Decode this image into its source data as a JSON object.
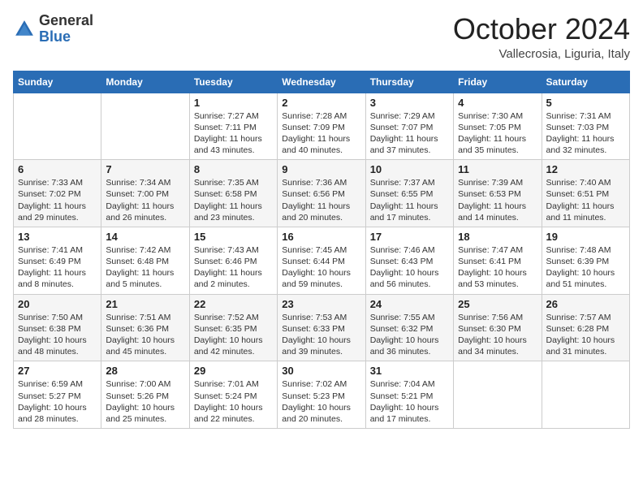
{
  "header": {
    "logo_general": "General",
    "logo_blue": "Blue",
    "month_title": "October 2024",
    "subtitle": "Vallecrosia, Liguria, Italy"
  },
  "days_of_week": [
    "Sunday",
    "Monday",
    "Tuesday",
    "Wednesday",
    "Thursday",
    "Friday",
    "Saturday"
  ],
  "weeks": [
    [
      {
        "day": "",
        "sunrise": "",
        "sunset": "",
        "daylight": ""
      },
      {
        "day": "",
        "sunrise": "",
        "sunset": "",
        "daylight": ""
      },
      {
        "day": "1",
        "sunrise": "Sunrise: 7:27 AM",
        "sunset": "Sunset: 7:11 PM",
        "daylight": "Daylight: 11 hours and 43 minutes."
      },
      {
        "day": "2",
        "sunrise": "Sunrise: 7:28 AM",
        "sunset": "Sunset: 7:09 PM",
        "daylight": "Daylight: 11 hours and 40 minutes."
      },
      {
        "day": "3",
        "sunrise": "Sunrise: 7:29 AM",
        "sunset": "Sunset: 7:07 PM",
        "daylight": "Daylight: 11 hours and 37 minutes."
      },
      {
        "day": "4",
        "sunrise": "Sunrise: 7:30 AM",
        "sunset": "Sunset: 7:05 PM",
        "daylight": "Daylight: 11 hours and 35 minutes."
      },
      {
        "day": "5",
        "sunrise": "Sunrise: 7:31 AM",
        "sunset": "Sunset: 7:03 PM",
        "daylight": "Daylight: 11 hours and 32 minutes."
      }
    ],
    [
      {
        "day": "6",
        "sunrise": "Sunrise: 7:33 AM",
        "sunset": "Sunset: 7:02 PM",
        "daylight": "Daylight: 11 hours and 29 minutes."
      },
      {
        "day": "7",
        "sunrise": "Sunrise: 7:34 AM",
        "sunset": "Sunset: 7:00 PM",
        "daylight": "Daylight: 11 hours and 26 minutes."
      },
      {
        "day": "8",
        "sunrise": "Sunrise: 7:35 AM",
        "sunset": "Sunset: 6:58 PM",
        "daylight": "Daylight: 11 hours and 23 minutes."
      },
      {
        "day": "9",
        "sunrise": "Sunrise: 7:36 AM",
        "sunset": "Sunset: 6:56 PM",
        "daylight": "Daylight: 11 hours and 20 minutes."
      },
      {
        "day": "10",
        "sunrise": "Sunrise: 7:37 AM",
        "sunset": "Sunset: 6:55 PM",
        "daylight": "Daylight: 11 hours and 17 minutes."
      },
      {
        "day": "11",
        "sunrise": "Sunrise: 7:39 AM",
        "sunset": "Sunset: 6:53 PM",
        "daylight": "Daylight: 11 hours and 14 minutes."
      },
      {
        "day": "12",
        "sunrise": "Sunrise: 7:40 AM",
        "sunset": "Sunset: 6:51 PM",
        "daylight": "Daylight: 11 hours and 11 minutes."
      }
    ],
    [
      {
        "day": "13",
        "sunrise": "Sunrise: 7:41 AM",
        "sunset": "Sunset: 6:49 PM",
        "daylight": "Daylight: 11 hours and 8 minutes."
      },
      {
        "day": "14",
        "sunrise": "Sunrise: 7:42 AM",
        "sunset": "Sunset: 6:48 PM",
        "daylight": "Daylight: 11 hours and 5 minutes."
      },
      {
        "day": "15",
        "sunrise": "Sunrise: 7:43 AM",
        "sunset": "Sunset: 6:46 PM",
        "daylight": "Daylight: 11 hours and 2 minutes."
      },
      {
        "day": "16",
        "sunrise": "Sunrise: 7:45 AM",
        "sunset": "Sunset: 6:44 PM",
        "daylight": "Daylight: 10 hours and 59 minutes."
      },
      {
        "day": "17",
        "sunrise": "Sunrise: 7:46 AM",
        "sunset": "Sunset: 6:43 PM",
        "daylight": "Daylight: 10 hours and 56 minutes."
      },
      {
        "day": "18",
        "sunrise": "Sunrise: 7:47 AM",
        "sunset": "Sunset: 6:41 PM",
        "daylight": "Daylight: 10 hours and 53 minutes."
      },
      {
        "day": "19",
        "sunrise": "Sunrise: 7:48 AM",
        "sunset": "Sunset: 6:39 PM",
        "daylight": "Daylight: 10 hours and 51 minutes."
      }
    ],
    [
      {
        "day": "20",
        "sunrise": "Sunrise: 7:50 AM",
        "sunset": "Sunset: 6:38 PM",
        "daylight": "Daylight: 10 hours and 48 minutes."
      },
      {
        "day": "21",
        "sunrise": "Sunrise: 7:51 AM",
        "sunset": "Sunset: 6:36 PM",
        "daylight": "Daylight: 10 hours and 45 minutes."
      },
      {
        "day": "22",
        "sunrise": "Sunrise: 7:52 AM",
        "sunset": "Sunset: 6:35 PM",
        "daylight": "Daylight: 10 hours and 42 minutes."
      },
      {
        "day": "23",
        "sunrise": "Sunrise: 7:53 AM",
        "sunset": "Sunset: 6:33 PM",
        "daylight": "Daylight: 10 hours and 39 minutes."
      },
      {
        "day": "24",
        "sunrise": "Sunrise: 7:55 AM",
        "sunset": "Sunset: 6:32 PM",
        "daylight": "Daylight: 10 hours and 36 minutes."
      },
      {
        "day": "25",
        "sunrise": "Sunrise: 7:56 AM",
        "sunset": "Sunset: 6:30 PM",
        "daylight": "Daylight: 10 hours and 34 minutes."
      },
      {
        "day": "26",
        "sunrise": "Sunrise: 7:57 AM",
        "sunset": "Sunset: 6:28 PM",
        "daylight": "Daylight: 10 hours and 31 minutes."
      }
    ],
    [
      {
        "day": "27",
        "sunrise": "Sunrise: 6:59 AM",
        "sunset": "Sunset: 5:27 PM",
        "daylight": "Daylight: 10 hours and 28 minutes."
      },
      {
        "day": "28",
        "sunrise": "Sunrise: 7:00 AM",
        "sunset": "Sunset: 5:26 PM",
        "daylight": "Daylight: 10 hours and 25 minutes."
      },
      {
        "day": "29",
        "sunrise": "Sunrise: 7:01 AM",
        "sunset": "Sunset: 5:24 PM",
        "daylight": "Daylight: 10 hours and 22 minutes."
      },
      {
        "day": "30",
        "sunrise": "Sunrise: 7:02 AM",
        "sunset": "Sunset: 5:23 PM",
        "daylight": "Daylight: 10 hours and 20 minutes."
      },
      {
        "day": "31",
        "sunrise": "Sunrise: 7:04 AM",
        "sunset": "Sunset: 5:21 PM",
        "daylight": "Daylight: 10 hours and 17 minutes."
      },
      {
        "day": "",
        "sunrise": "",
        "sunset": "",
        "daylight": ""
      },
      {
        "day": "",
        "sunrise": "",
        "sunset": "",
        "daylight": ""
      }
    ]
  ]
}
